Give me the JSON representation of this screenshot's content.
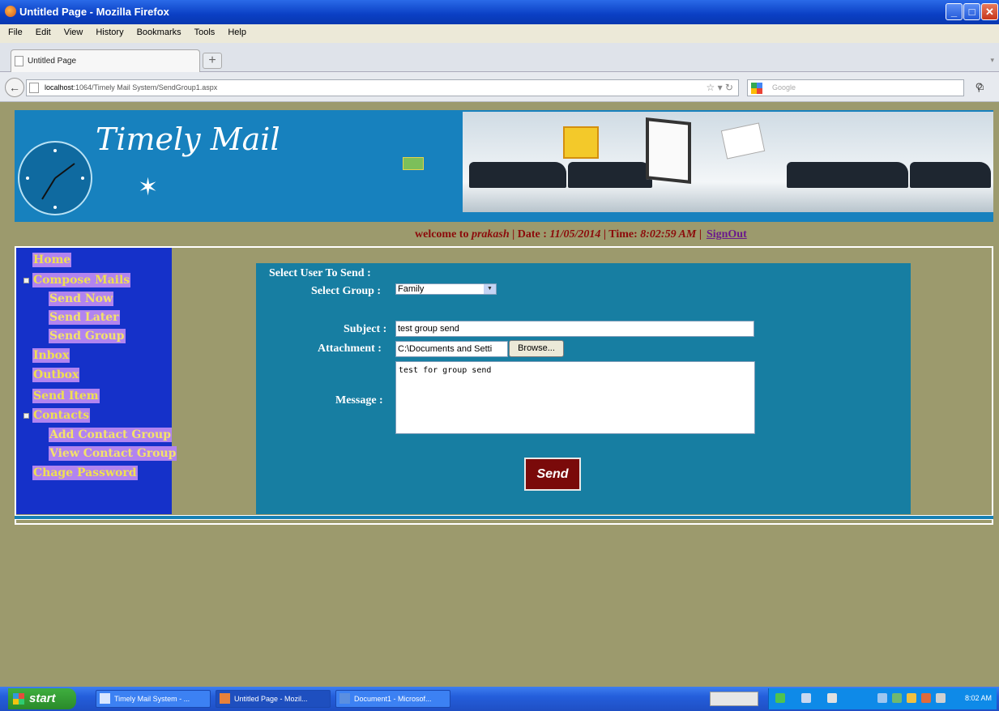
{
  "window": {
    "title": "Untitled Page - Mozilla Firefox",
    "controls": [
      "minimize-icon",
      "maximize-icon",
      "close-icon"
    ]
  },
  "menu": [
    "File",
    "Edit",
    "View",
    "History",
    "Bookmarks",
    "Tools",
    "Help"
  ],
  "tab": {
    "label": "Untitled Page",
    "new_tab": "+"
  },
  "address": {
    "host": "localhost",
    "path": ":1064/Timely Mail System/SendGroup1.aspx",
    "search_placeholder": "Google"
  },
  "site": {
    "logo": "Timely Mail"
  },
  "welcome": {
    "prefix": "welcome to",
    "user": "prakash",
    "date_label": "| Date :",
    "date": "11/05/2014",
    "time_label": "| Time:",
    "time": "8:02:59 AM",
    "sep": "|",
    "signout": "SignOut"
  },
  "sidebar": {
    "home": "Home",
    "compose": "Compose Mails",
    "send_now": "Send Now",
    "send_later": "Send Later",
    "send_group": "Send Group",
    "inbox": "Inbox",
    "outbox": "Outbox",
    "send_item": "Send Item",
    "contacts": "Contacts",
    "add_contact_group": "Add Contact Group",
    "view_contact_group": "View Contact Group",
    "change_password": "Chage Password"
  },
  "form": {
    "select_user_label": "Select User To Send :",
    "select_group_label": "Select Group :",
    "group_value": "Family",
    "subject_label": "Subject :",
    "subject_value": "test group send",
    "attachment_label": "Attachment :",
    "attachment_value": "C:\\Documents and Setti",
    "browse_label": "Browse...",
    "message_label": "Message :",
    "message_value": "test for group send",
    "send_label": "Send"
  },
  "taskbar": {
    "start": "start",
    "items": [
      "Timely Mail System - ...",
      "Untitled Page - Mozil...",
      "Document1 - Microsof..."
    ],
    "clock": "8:02 AM"
  }
}
